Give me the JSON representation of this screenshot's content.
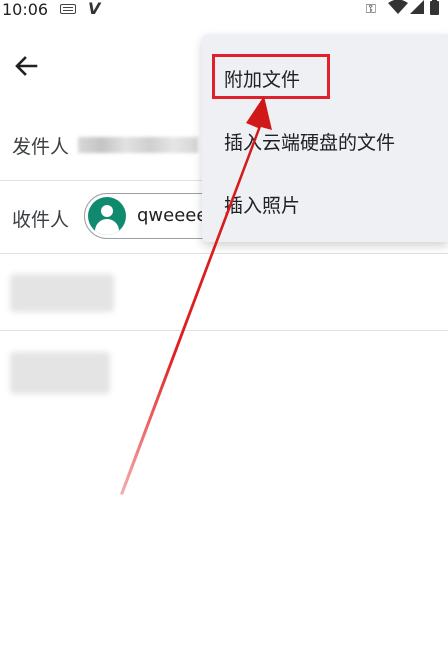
{
  "status_bar": {
    "time": "10:06"
  },
  "compose": {
    "from_label": "发件人",
    "to_label": "收件人",
    "recipient_chip": "qweeee"
  },
  "menu": {
    "items": [
      {
        "label": "附加文件"
      },
      {
        "label": "插入云端硬盘的文件"
      },
      {
        "label": "插入照片"
      }
    ]
  },
  "colors": {
    "avatar": "#0f8a6e",
    "highlight": "#e0202a",
    "menu_bg": "#eef0f4"
  }
}
